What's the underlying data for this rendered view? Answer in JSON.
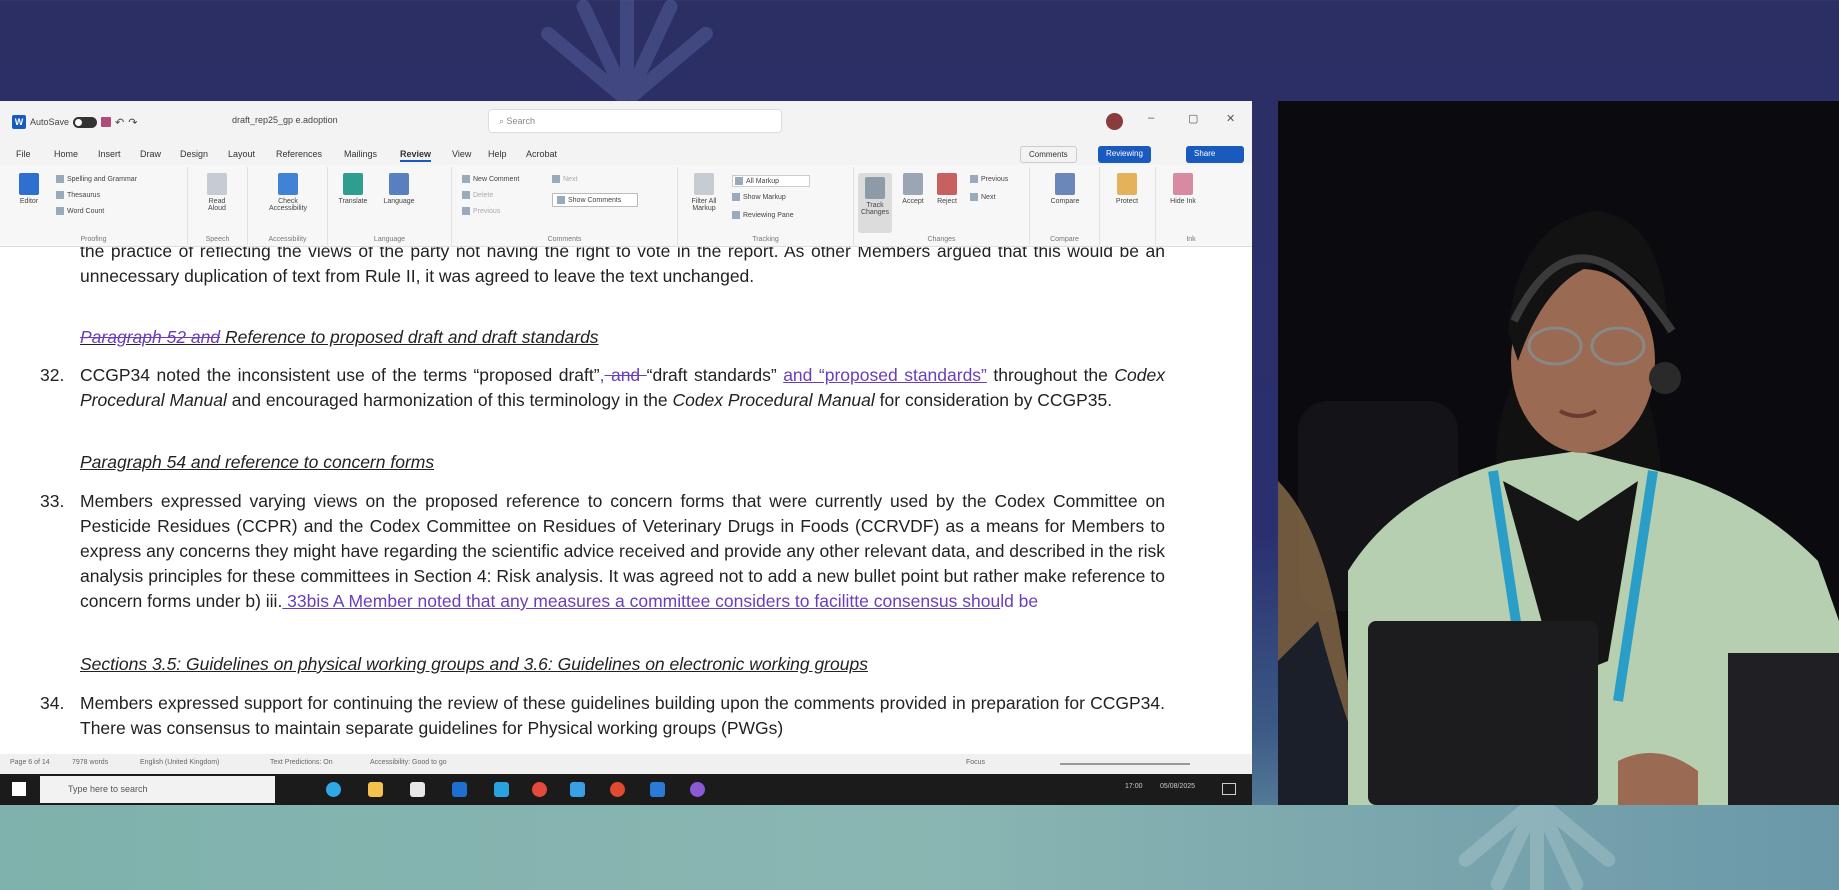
{
  "word": {
    "autosave_label": "AutoSave",
    "filename": "draft_rep25_gp e.adoption",
    "search_placeholder": "Search",
    "tabs": [
      "File",
      "Home",
      "Insert",
      "Draw",
      "Design",
      "Layout",
      "References",
      "Mailings",
      "Review",
      "View",
      "Help",
      "Acrobat"
    ],
    "active_tab": "Review",
    "comments_button": "Comments",
    "reviewing_button": "Reviewing",
    "share_button": "Share",
    "ribbon": {
      "proofing": {
        "spelling": "Spelling and Grammar",
        "thesaurus": "Thesaurus",
        "word_count": "Word Count",
        "label": "Proofing"
      },
      "editor": "Editor",
      "read_aloud": "Read Aloud",
      "speech_label": "Speech",
      "check_accessibility": "Check Accessibility",
      "accessibility_label": "Accessibility",
      "translate": "Translate",
      "language_btn": "Language",
      "language_label": "Language",
      "new_comment": "New Comment",
      "delete": "Delete",
      "previous": "Previous",
      "next": "Next",
      "show_comments": "Show Comments",
      "comments_label": "Comments",
      "filter_markup": "Filter All Markup",
      "all_markup": "All Markup",
      "show_markup": "Show Markup",
      "reviewing_pane": "Reviewing Pane",
      "tracking_label": "Tracking",
      "track_changes": "Track Changes",
      "accept": "Accept",
      "reject": "Reject",
      "prev_change": "Previous",
      "next_change": "Next",
      "changes_label": "Changes",
      "compare": "Compare",
      "compare_label": "Compare",
      "protect": "Protect",
      "hide_ink": "Hide Ink",
      "ink_label": "Ink"
    },
    "document": {
      "cut_line": "the practice of reflecting the views of the party not having the right to vote in the report. As other Members argued that this would be an unnecessary duplication of text from Rule II, it was agreed to leave the text unchanged.",
      "heading1_del": "Paragraph 52 and",
      "heading1_rest": " Reference to proposed draft and draft standards",
      "p32_num": "32.",
      "p32_a": "CCGP34 noted the inconsistent use of the terms “proposed draft”",
      "p32_ins1": ",",
      "p32_del": " and ",
      "p32_b": "“draft standards” ",
      "p32_ins2": "and “proposed standards”",
      "p32_c": " throughout the ",
      "p32_manual1": "Codex Procedural Manual",
      "p32_d": " and encouraged harmonization of this terminology in the ",
      "p32_manual2": "Codex Procedural Manual",
      "p32_e": " for consideration by CCGP35.",
      "heading2": "Paragraph 54 and reference to concern forms",
      "p33_num": "33.",
      "p33_text": "Members expressed varying views on the proposed reference to concern forms that were currently used by the Codex Committee on Pesticide Residues (CCPR) and the Codex Committee on Residues of Veterinary Drugs in Foods (CCRVDF) as a means for Members to express any concerns they might have regarding the scientific advice received and provide any other relevant data, and described in the risk analysis principles for these committees in Section 4: Risk analysis. It was agreed not to add a new bullet point but rather make reference to concern forms under b) iii.",
      "p33_ins": " 33bis A Member noted that any measures a committee considers to facilitte consensus shou",
      "p33_typing": "ld be",
      "heading3": "Sections 3.5: Guidelines on physical working groups and 3.6: Guidelines on electronic working groups",
      "p34_num": "34.",
      "p34_text": "Members expressed support for continuing the review of these guidelines building upon the comments provided in preparation for CCGP34. There was consensus to maintain separate guidelines for Physical working groups (PWGs)"
    },
    "status": {
      "page": "Page 6 of 14",
      "words": "7978 words",
      "language": "English (United Kingdom)",
      "text_predictions": "Text Predictions: On",
      "accessibility": "Accessibility: Good to go",
      "focus": "Focus"
    }
  },
  "taskbar": {
    "search_placeholder": "Type here to search",
    "time": "17:00",
    "date": "05/08/2025"
  },
  "colors": {
    "word_blue": "#185abd",
    "track_change": "#6a3dbb",
    "blazer": "#b6cfb0",
    "lanyard": "#2a9ec7"
  },
  "icons": [
    "word-icon",
    "save-icon",
    "undo-icon",
    "redo-icon",
    "search-icon",
    "windows-start-icon",
    "edge-icon",
    "folder-icon",
    "chrome-icon",
    "outlook-icon"
  ]
}
